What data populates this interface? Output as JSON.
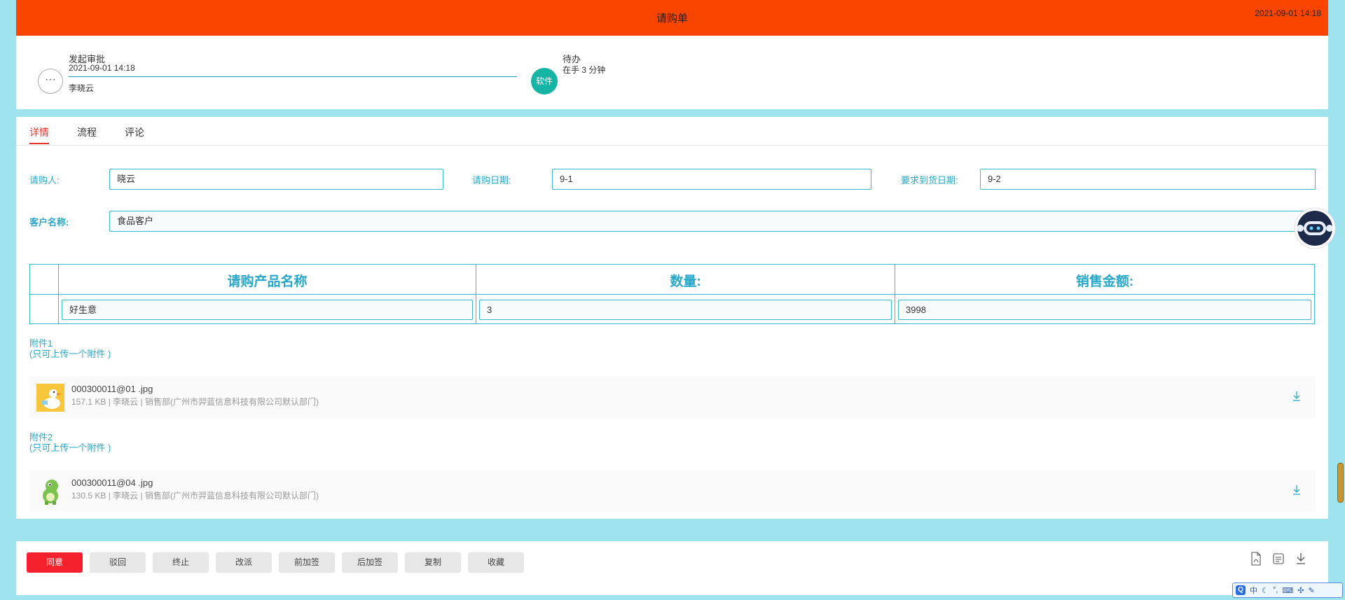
{
  "header": {
    "title": "请购单",
    "datetime": "2021-09-01 14:18"
  },
  "approval": {
    "more_label": "···",
    "step1": {
      "title": "发起审批",
      "time": "2021-09-01 14:18",
      "user": "李晓云"
    },
    "step2": {
      "avatar_text": "软件",
      "title": "待办",
      "duration": "在手 3 分钟"
    }
  },
  "tabs": [
    {
      "label": "详情"
    },
    {
      "label": "流程"
    },
    {
      "label": "评论"
    }
  ],
  "form": {
    "requester": {
      "label": "请购人:",
      "value": "晓云"
    },
    "request_date": {
      "label": "请购日期:",
      "value": "9-1"
    },
    "arrival_date": {
      "label": "要求到货日期:",
      "value": "9-2"
    },
    "customer": {
      "label": "客户名称:",
      "value": "食品客户"
    }
  },
  "product_table": {
    "headers": [
      "请购产品名称",
      "数量:",
      "销售金额:"
    ],
    "rows": [
      {
        "product": "好生意",
        "quantity": "3",
        "amount": "3998"
      }
    ]
  },
  "attachments": [
    {
      "label": "附件1",
      "hint": "(只可上传一个附件 )",
      "file": {
        "name": "000300011@01 .jpg",
        "meta": "157.1 KB | 李晓云 | 销售部(广州市羿蓝信息科技有限公司默认部门)"
      }
    },
    {
      "label": "附件2",
      "hint": "(只可上传一个附件 )",
      "file": {
        "name": "000300011@04 .jpg",
        "meta": "130.5 KB | 李晓云 | 销售部(广州市羿蓝信息科技有限公司默认部门)"
      }
    }
  ],
  "actions": {
    "agree": "同意",
    "reject": "驳回",
    "terminate": "终止",
    "reassign": "改派",
    "pre_sign": "前加签",
    "post_sign": "后加签",
    "copy": "复制",
    "favorite": "收藏"
  },
  "ime": {
    "logo": "Q",
    "lang": "中"
  },
  "colors": {
    "header": "#fa4501",
    "accent": "#28a8c8",
    "primary_button": "#f5222d",
    "active_tab": "#e8342c",
    "badge": "#15b4a4"
  }
}
